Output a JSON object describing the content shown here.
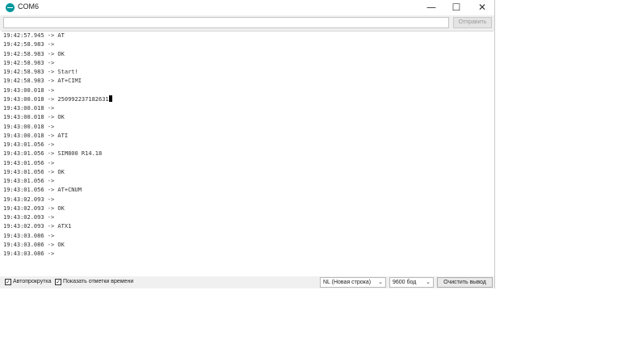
{
  "window": {
    "title": "COM6",
    "controls": {
      "minimize": "—",
      "maximize": "☐",
      "close": "✕"
    }
  },
  "send": {
    "input_value": "",
    "button_label": "Отправить"
  },
  "console": {
    "lines": [
      "19:42:57.945 -> AT",
      "19:42:58.983 ->",
      "19:42:58.983 -> OK",
      "19:42:58.983 ->",
      "19:42:58.983 -> Start!",
      "19:42:58.983 -> AT+CIMI",
      "19:43:00.018 ->",
      "19:43:00.018 -> 250992237182631",
      "19:43:00.018 ->",
      "19:43:00.018 -> OK",
      "19:43:00.018 ->",
      "19:43:00.018 -> ATI",
      "19:43:01.056 ->",
      "19:43:01.056 -> SIM800 R14.18",
      "19:43:01.056 ->",
      "19:43:01.056 -> OK",
      "19:43:01.056 ->",
      "19:43:01.056 -> AT+CNUM",
      "19:43:02.093 ->",
      "19:43:02.093 -> OK",
      "19:43:02.093 ->",
      "19:43:02.093 -> ATX1",
      "19:43:03.086 ->",
      "19:43:03.086 -> OK",
      "19:43:03.086 ->"
    ],
    "cursor_line": 7
  },
  "statusbar": {
    "autoscroll": {
      "label": "Автопрокрутка",
      "checked": true
    },
    "timestamps": {
      "label": "Показать отметки времени",
      "checked": true
    },
    "line_ending": "NL (Новая строка)",
    "baud": "9600 бод",
    "clear_label": "Очистить вывод"
  },
  "colors": {
    "accent": "#00979c",
    "toolbar_bg": "#f0f0f0",
    "console_text": "#333333"
  }
}
